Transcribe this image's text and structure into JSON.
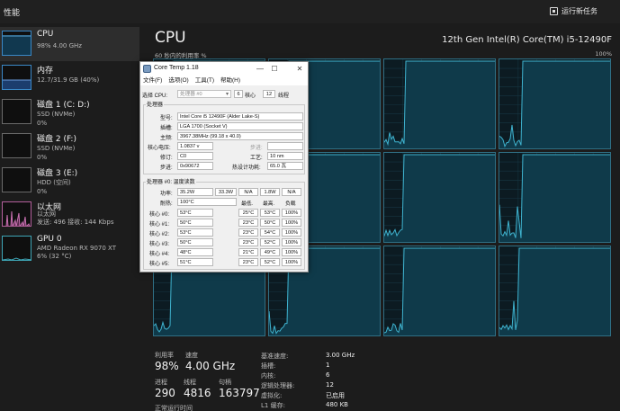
{
  "topbar": {
    "title": "性能",
    "run_task": "运行新任务"
  },
  "sidebar": [
    {
      "name": "CPU",
      "sub1": "98% 4.00 GHz",
      "sub2": ""
    },
    {
      "name": "内存",
      "sub1": "12.7/31.9 GB (40%)",
      "sub2": ""
    },
    {
      "name": "磁盘 1 (C: D:)",
      "sub1": "SSD (NVMe)",
      "sub2": "0%"
    },
    {
      "name": "磁盘 2 (F:)",
      "sub1": "SSD (NVMe)",
      "sub2": "0%"
    },
    {
      "name": "磁盘 3 (E:)",
      "sub1": "HDD (空间)",
      "sub2": "0%"
    },
    {
      "name": "以太网",
      "sub1": "以太网",
      "sub2": "发送: 496 接收: 144 Kbps"
    },
    {
      "name": "GPU 0",
      "sub1": "AMD Radeon RX 9070 XT",
      "sub2": "6% (32 °C)"
    }
  ],
  "main": {
    "title": "CPU",
    "model": "12th Gen Intel(R) Core(TM) i5-12490F",
    "util_label": "60 秒内的利用率 %",
    "max_label": "100%"
  },
  "stats": {
    "util_label": "利用率",
    "util_value": "98%",
    "speed_label": "速度",
    "speed_value": "4.00 GHz",
    "proc_label": "进程",
    "proc_value": "290",
    "thread_label": "线程",
    "thread_value": "4816",
    "handle_label": "句柄",
    "handle_value": "163797",
    "uptime_label": "正常运行时间"
  },
  "specs": [
    {
      "label": "基准速度:",
      "value": "3.00 GHz"
    },
    {
      "label": "插槽:",
      "value": "1"
    },
    {
      "label": "内核:",
      "value": "6"
    },
    {
      "label": "逻辑处理器:",
      "value": "12"
    },
    {
      "label": "虚拟化:",
      "value": "已启用"
    },
    {
      "label": "L1 缓存:",
      "value": "480 KB"
    }
  ],
  "coretemp": {
    "title": "Core Temp 1.18",
    "menu": [
      "文件(F)",
      "选项(O)",
      "工具(T)",
      "帮助(H)"
    ],
    "select_cpu": "选择 CPU:",
    "cpu_combo": "处理器 #0",
    "cores_count": "6",
    "cores_label": "核心",
    "threads_count": "12",
    "threads_label": "线程",
    "processor_group": "处理器",
    "model_label": "型号:",
    "model_value": "Intel Core i5 12490F (Alder Lake-S)",
    "socket_label": "插槽:",
    "socket_value": "LGA 1700 (Socket V)",
    "freq_label": "主频:",
    "freq_value": "3967.38MHz (99.18 x 40.0)",
    "vid_label": "核心电压:",
    "vid_value": "1.0837 v",
    "stepping_right_label": "步进:",
    "rev_label": "修订:",
    "rev_value": "C0",
    "lith_label": "工艺:",
    "lith_value": "10 nm",
    "step_label": "步进:",
    "step_value": "0x90672",
    "tdp_label": "热设计功耗:",
    "tdp_value": "65.0 瓦",
    "temp_group": "处理器 #0: 温度读数",
    "power_label": "功率:",
    "power_values": [
      "35.2W",
      "33.3W",
      "N/A",
      "1.8W",
      "N/A"
    ],
    "tjmax_label": "耐热:",
    "tjmax_value": "100°C",
    "col_min": "最低.",
    "col_max": "最高.",
    "col_load": "负载",
    "cores": [
      {
        "label": "核心 #0:",
        "temp": "53°C",
        "min": "25°C",
        "max": "53°C",
        "load": "100%"
      },
      {
        "label": "核心 #1:",
        "temp": "50°C",
        "min": "23°C",
        "max": "50°C",
        "load": "100%"
      },
      {
        "label": "核心 #2:",
        "temp": "53°C",
        "min": "23°C",
        "max": "54°C",
        "load": "100%"
      },
      {
        "label": "核心 #3:",
        "temp": "50°C",
        "min": "23°C",
        "max": "52°C",
        "load": "100%"
      },
      {
        "label": "核心 #4:",
        "temp": "48°C",
        "min": "21°C",
        "max": "49°C",
        "load": "100%"
      },
      {
        "label": "核心 #5:",
        "temp": "51°C",
        "min": "23°C",
        "max": "52°C",
        "load": "100%"
      }
    ]
  }
}
